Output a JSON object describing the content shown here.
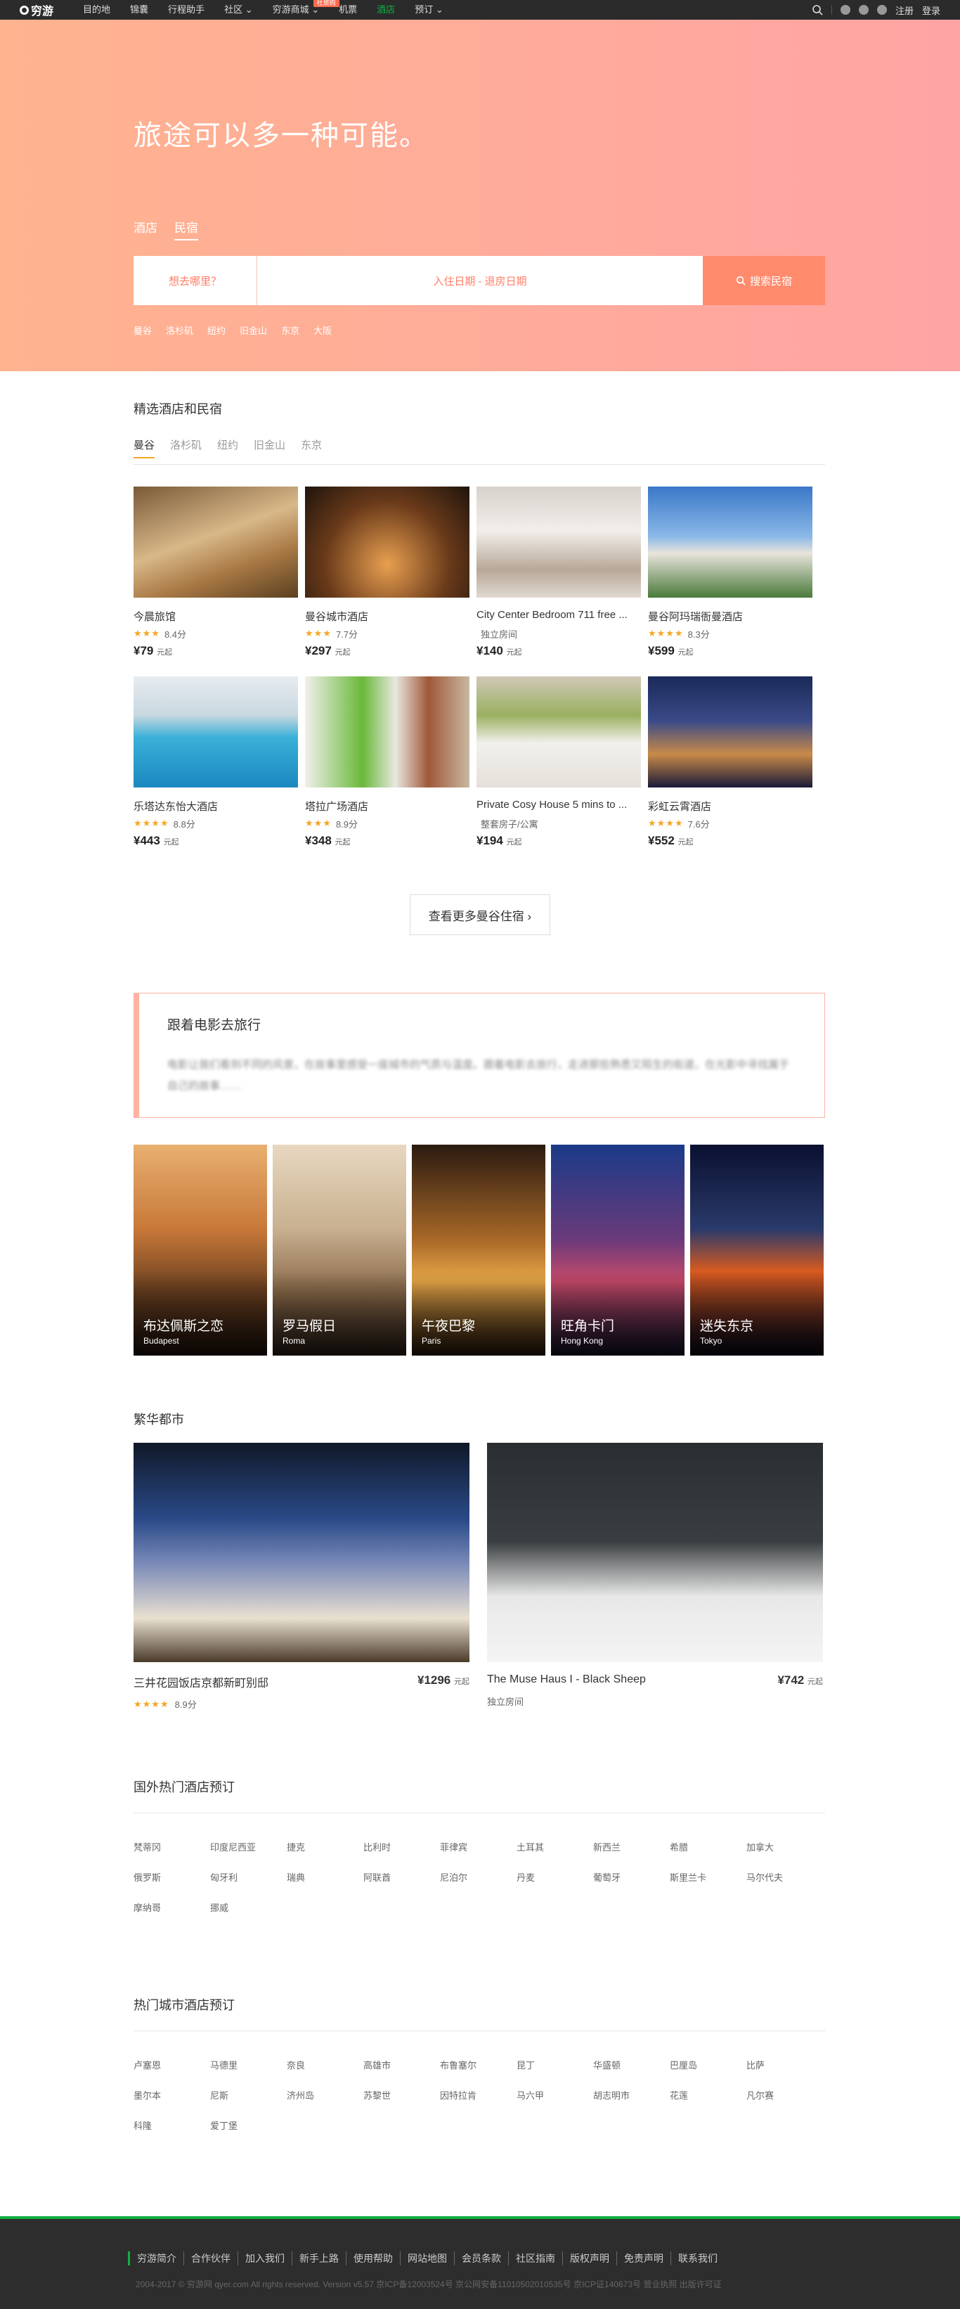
{
  "nav": {
    "logo": "穷游",
    "items": [
      "目的地",
      "锦囊",
      "行程助手",
      "社区",
      "穷游商城",
      "机票",
      "酒店",
      "预订"
    ],
    "badge": "社旅购",
    "right": [
      "注册",
      "登录"
    ]
  },
  "hero": {
    "title": "旅途可以多一种可能。",
    "tabs": [
      "酒店",
      "民宿"
    ],
    "dest_placeholder": "想去哪里？",
    "dates_placeholder": "入住日期 - 退房日期",
    "search_label": "搜索民宿",
    "cities": [
      "曼谷",
      "洛杉矶",
      "纽约",
      "旧金山",
      "东京",
      "大阪"
    ]
  },
  "featured": {
    "title": "精选酒店和民宿",
    "tabs": [
      "曼谷",
      "洛杉矶",
      "纽约",
      "旧金山",
      "东京"
    ],
    "hotels": [
      {
        "name": "今晨旅馆",
        "stars": "★★★",
        "score": "8.4分",
        "price": "¥79",
        "unit": "元起"
      },
      {
        "name": "曼谷城市酒店",
        "stars": "★★★",
        "score": "7.7分",
        "price": "¥297",
        "unit": "元起"
      },
      {
        "name": "City Center Bedroom 711 free ...",
        "stars": "",
        "score": "独立房间",
        "price": "¥140",
        "unit": "元起"
      },
      {
        "name": "曼谷阿玛瑞衙曼酒店",
        "stars": "★★★★",
        "score": "8.3分",
        "price": "¥599",
        "unit": "元起"
      },
      {
        "name": "乐塔达东怡大酒店",
        "stars": "★★★★",
        "score": "8.8分",
        "price": "¥443",
        "unit": "元起"
      },
      {
        "name": "塔拉广场酒店",
        "stars": "★★★",
        "score": "8.9分",
        "price": "¥348",
        "unit": "元起"
      },
      {
        "name": "Private Cosy House 5 mins to ...",
        "stars": "",
        "score": "整套房子/公寓",
        "price": "¥194",
        "unit": "元起"
      },
      {
        "name": "彩虹云霄酒店",
        "stars": "★★★★",
        "score": "7.6分",
        "price": "¥552",
        "unit": "元起"
      }
    ],
    "more": "查看更多曼谷住宿 ›"
  },
  "film": {
    "title": "跟着电影去旅行",
    "text": "电影让我们看到不同的风景，在故事里感受一座城市的气质与温度。跟着电影去旅行，走进那些熟悉又陌生的街道，在光影中寻找属于自己的故事……"
  },
  "movies": [
    {
      "title": "布达佩斯之恋",
      "sub": "Budapest"
    },
    {
      "title": "罗马假日",
      "sub": "Roma"
    },
    {
      "title": "午夜巴黎",
      "sub": "Paris"
    },
    {
      "title": "旺角卡门",
      "sub": "Hong Kong"
    },
    {
      "title": "迷失东京",
      "sub": "Tokyo"
    }
  ],
  "urban": {
    "title": "繁华都市",
    "cards": [
      {
        "name": "三井花园饭店京都新町别邸",
        "price": "¥1296",
        "unit": "元起",
        "stars": "★★★★",
        "score": "8.9分"
      },
      {
        "name": "The Muse Haus I - Black Sheep",
        "price": "¥742",
        "unit": "元起",
        "stars": "",
        "score": "独立房间"
      }
    ]
  },
  "intl": {
    "title": "国外热门酒店预订",
    "links": [
      "梵蒂冈",
      "印度尼西亚",
      "捷克",
      "比利时",
      "菲律宾",
      "土耳其",
      "新西兰",
      "希腊",
      "加拿大",
      "俄罗斯",
      "匈牙利",
      "瑞典",
      "阿联酋",
      "尼泊尔",
      "丹麦",
      "葡萄牙",
      "斯里兰卡",
      "马尔代夫",
      "摩纳哥",
      "挪威"
    ]
  },
  "cities": {
    "title": "热门城市酒店预订",
    "links": [
      "卢塞恩",
      "马德里",
      "奈良",
      "高雄市",
      "布鲁塞尔",
      "昆丁",
      "华盛顿",
      "巴厘岛",
      "比萨",
      "墨尔本",
      "尼斯",
      "济州岛",
      "苏黎世",
      "因特拉肯",
      "马六甲",
      "胡志明市",
      "花莲",
      "凡尔赛",
      "科隆",
      "爱丁堡"
    ]
  },
  "footer": {
    "links": [
      "穷游简介",
      "合作伙伴",
      "加入我们",
      "新手上路",
      "使用帮助",
      "网站地图",
      "会员条款",
      "社区指南",
      "版权声明",
      "免责声明",
      "联系我们"
    ],
    "copyright": "2004-2017 © 穷游网 qyer.com All rights reserved. Version v5.57 京ICP备12003524号 京公网安备11010502010535号 京ICP证140673号 营业执照 出版许可证"
  }
}
